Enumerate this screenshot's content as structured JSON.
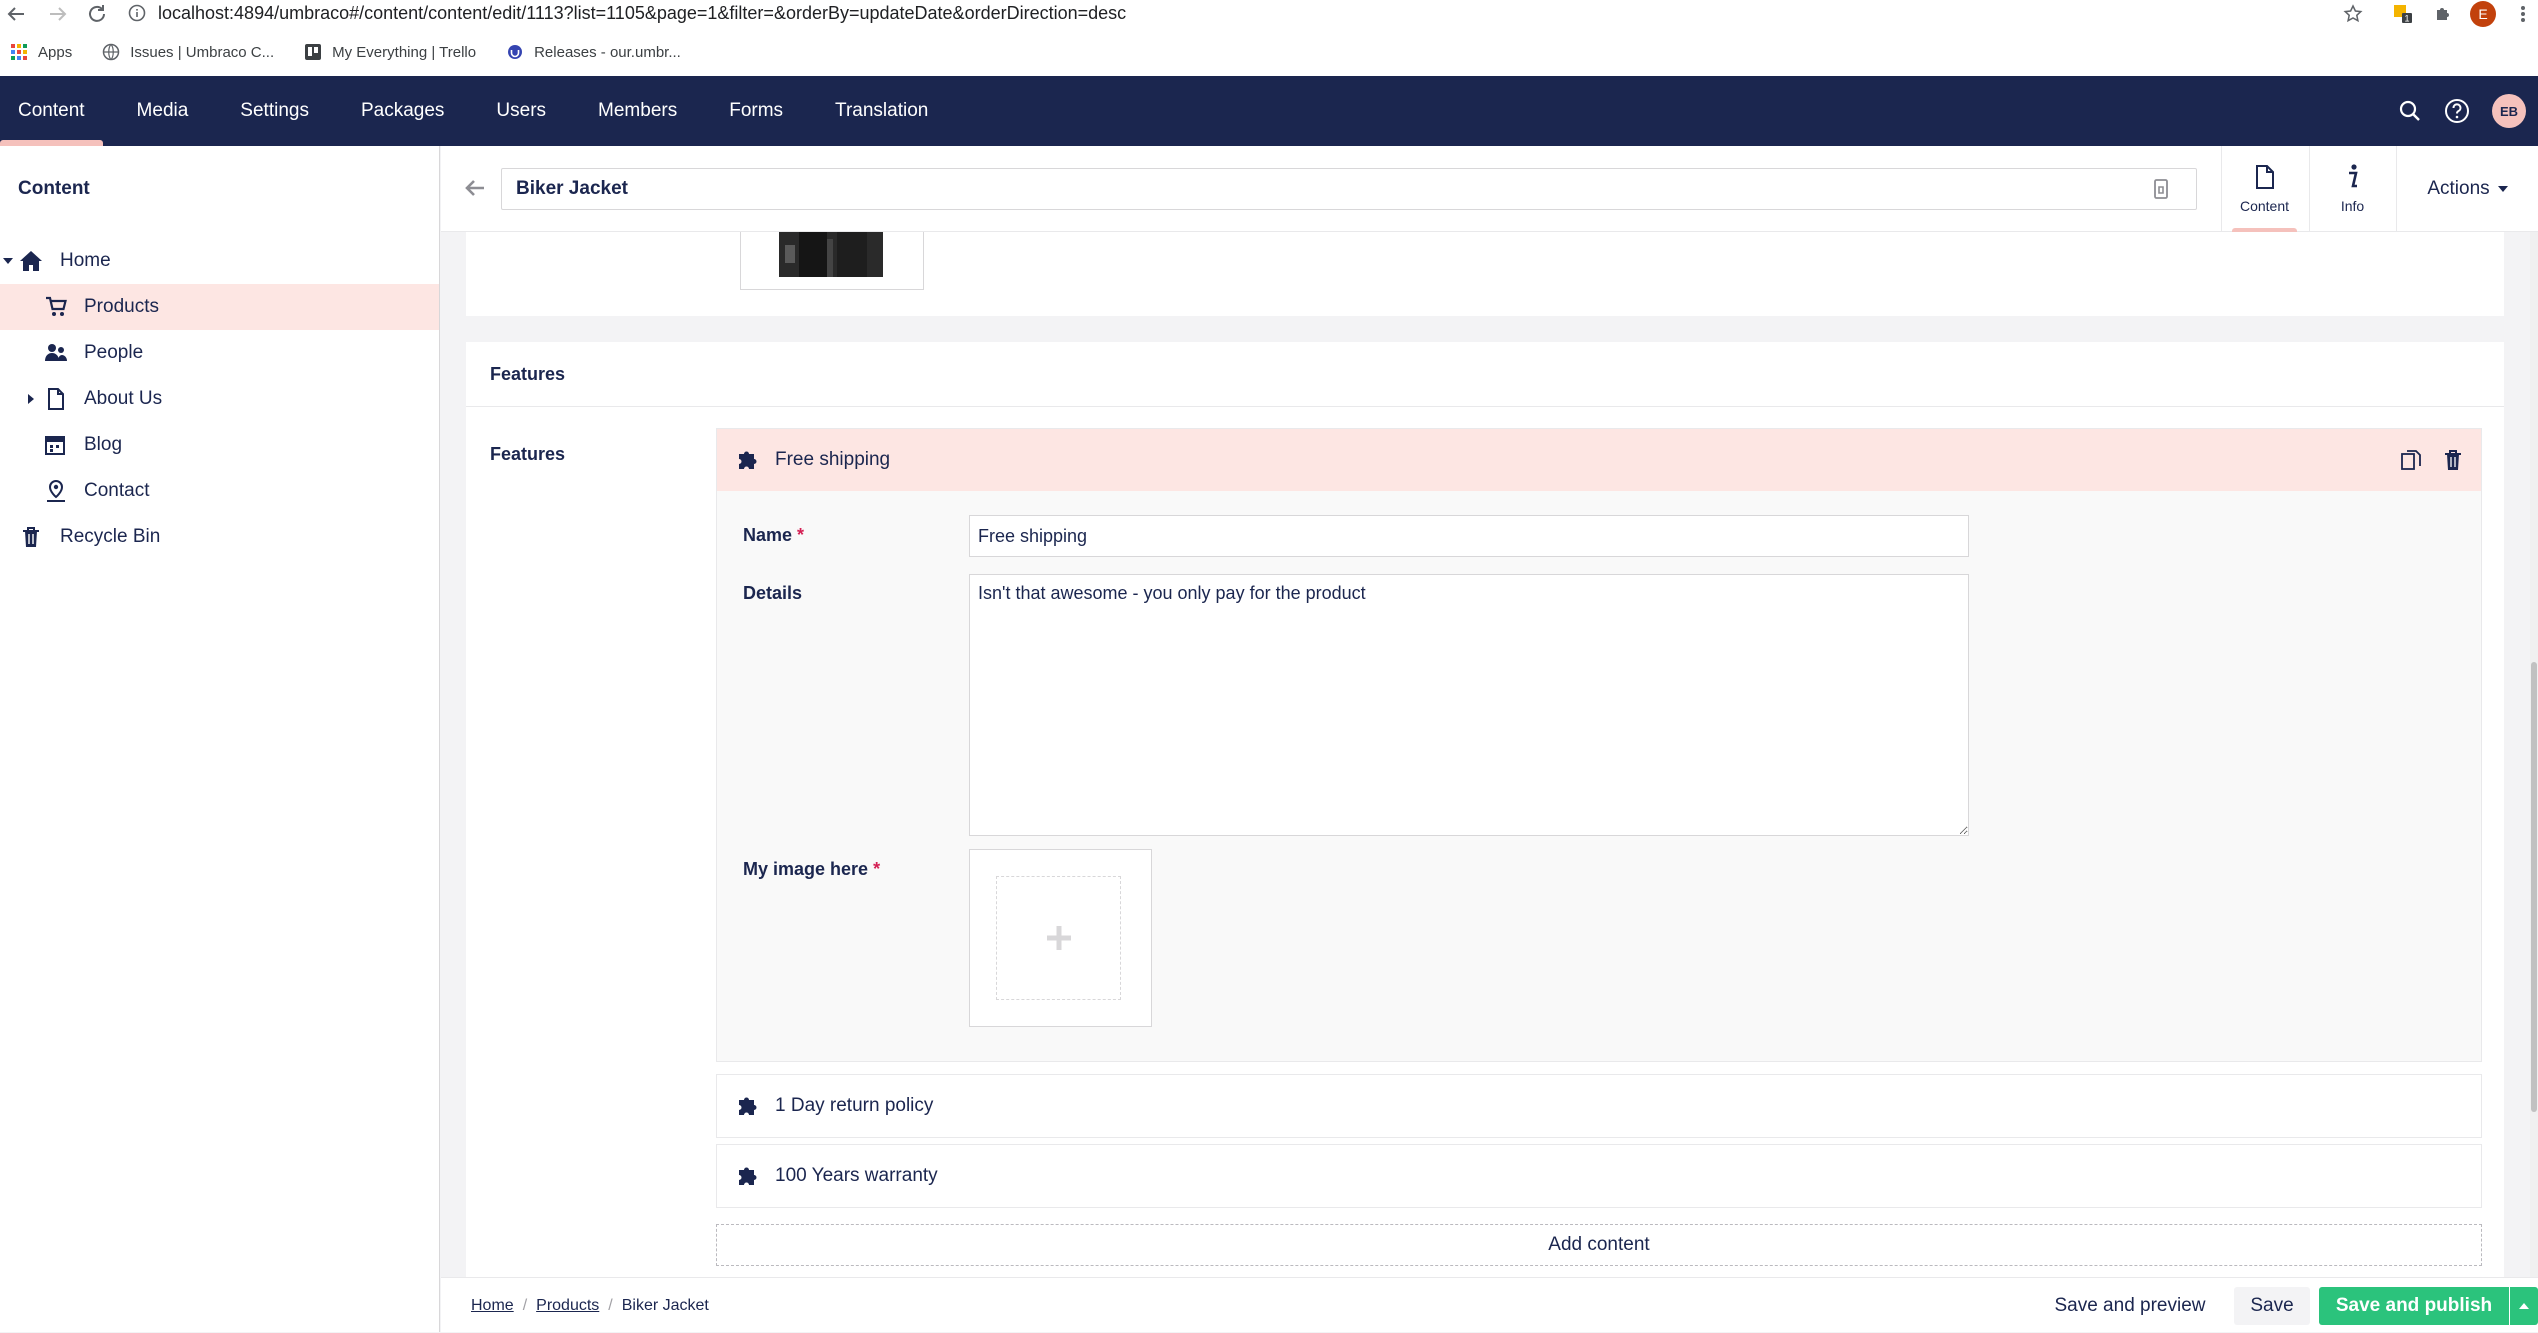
{
  "browser": {
    "url": "localhost:4894/umbraco#/content/content/edit/1113?list=1105&page=1&filter=&orderBy=updateDate&orderDirection=desc",
    "profile_initial": "E"
  },
  "bookmarks": [
    {
      "label": "Apps",
      "icon": "apps-grid-icon"
    },
    {
      "label": "Issues | Umbraco C...",
      "icon": "globe-icon"
    },
    {
      "label": "My Everything | Trello",
      "icon": "trello-icon"
    },
    {
      "label": "Releases - our.umbr...",
      "icon": "umbraco-icon"
    }
  ],
  "header": {
    "sections": [
      "Content",
      "Media",
      "Settings",
      "Packages",
      "Users",
      "Members",
      "Forms",
      "Translation"
    ],
    "active_section": "Content",
    "avatar_initials": "EB"
  },
  "tree": {
    "title": "Content",
    "items": [
      {
        "label": "Home",
        "icon": "home-icon",
        "selected": false
      },
      {
        "label": "Products",
        "icon": "cart-icon",
        "selected": true
      },
      {
        "label": "People",
        "icon": "people-icon",
        "selected": false
      },
      {
        "label": "About Us",
        "icon": "document-icon",
        "selected": false
      },
      {
        "label": "Blog",
        "icon": "calendar-icon",
        "selected": false
      },
      {
        "label": "Contact",
        "icon": "map-marker-icon",
        "selected": false
      },
      {
        "label": "Recycle Bin",
        "icon": "trash-icon",
        "selected": false
      }
    ]
  },
  "editor": {
    "name": "Biker Jacket",
    "apps": [
      {
        "label": "Content",
        "icon": "document-icon",
        "active": true
      },
      {
        "label": "Info",
        "icon": "info-icon",
        "active": false
      }
    ],
    "actions_label": "Actions"
  },
  "features_group": {
    "title": "Features",
    "property_label": "Features",
    "blocks": [
      {
        "title": "Free shipping",
        "expanded": true,
        "fields": {
          "name_label": "Name",
          "name_value": "Free shipping",
          "details_label": "Details",
          "details_value": "Isn't that awesome - you only pay for the product",
          "image_label": "My image here",
          "required_mark": "*"
        }
      },
      {
        "title": "1 Day return policy",
        "expanded": false
      },
      {
        "title": "100 Years warranty",
        "expanded": false
      }
    ],
    "add_content_label": "Add content"
  },
  "footer": {
    "breadcrumb": [
      "Home",
      "Products",
      "Biker Jacket"
    ],
    "separator": "/",
    "save_preview_label": "Save and preview",
    "save_label": "Save",
    "save_publish_label": "Save and publish"
  },
  "colors": {
    "header_bg": "#1b264f",
    "accent_pink": "#f5c1bc",
    "selected_bg": "#fde6e3",
    "publish_green": "#2bc37c",
    "required_red": "#d42054"
  }
}
